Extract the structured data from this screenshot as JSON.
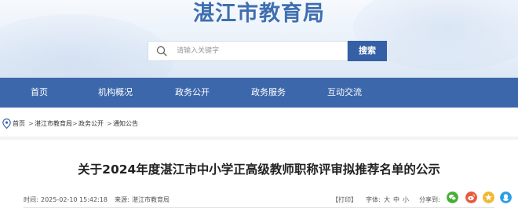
{
  "site": {
    "title": "湛江市教育局"
  },
  "search": {
    "placeholder": "请输入关键字",
    "button_label": "搜索"
  },
  "nav": {
    "items": [
      "首页",
      "机构概况",
      "政务公开",
      "政务服务",
      "互动交流"
    ]
  },
  "breadcrumb": {
    "items": [
      "首页",
      "湛江市教育局",
      "政务公开",
      "通知公告"
    ],
    "separator": ">"
  },
  "article": {
    "title": "关于2024年度湛江市中小学正高级教师职称评审拟推荐名单的公示",
    "time_label": "时间:",
    "time_value": "2025-02-10 15:42:18",
    "source_label": "来源:",
    "source_value": "湛江市教育局",
    "print_label": "【打印】",
    "font_label": "字体:",
    "font_sizes": [
      "大",
      "中",
      "小"
    ],
    "share_label": "分享到:"
  },
  "share": {
    "icons": [
      "wechat-icon",
      "weibo-icon",
      "qq-zone-icon",
      "qq-icon"
    ],
    "colors": [
      "#46b035",
      "#e85a3c",
      "#f1b832",
      "#2e9ee6"
    ]
  },
  "colors": {
    "brand": "#3c67ab",
    "title": "#3f6fb0",
    "search_button": "#3560a6"
  }
}
